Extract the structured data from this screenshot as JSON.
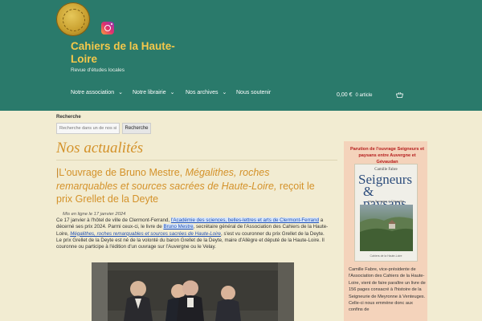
{
  "site": {
    "title": "Cahiers de la Haute-Loire",
    "tagline": "Revue d'études locales",
    "colors": {
      "header": "#2a7a6b",
      "title": "#f4c84a",
      "accent": "#d4922a",
      "background": "#f2ecd2"
    },
    "logo_icon": "gold-coin-logo",
    "social_icon": "instagram-icon"
  },
  "nav": {
    "items": [
      {
        "label": "Notre association",
        "has_dropdown": true
      },
      {
        "label": "Notre librairie",
        "has_dropdown": true
      },
      {
        "label": "Nos archives",
        "has_dropdown": true
      },
      {
        "label": "Nous soutenir",
        "has_dropdown": false
      }
    ],
    "cart": {
      "amount": "0,00 €",
      "count": "0 article",
      "icon": "basket-icon"
    }
  },
  "search": {
    "label": "Recherche",
    "placeholder": "Recherche dans un de nos si",
    "button": "Recherche"
  },
  "page": {
    "title": "Nos actualités"
  },
  "post": {
    "title_plain_1": "L'ouvrage de Bruno Mestre, ",
    "title_italic": "Mégalithes, roches remarquables et sources sacrées de Haute-Loire,",
    "title_plain_2": " reçoit le prix Grellet de la Deyte",
    "meta": "Mis en ligne le 17 janvier 2024",
    "p1_a": "Ce 17 janvier à l'hôtel de ville de Clermont-Ferrand, ",
    "p1_link": "l'Académie des sciences, belles-lettres et arts de Clermont-Ferrand",
    "p1_b": " a décerné ses prix 2024. Parmi ceux-ci, le livre de ",
    "p1_author": "Bruno Mestre",
    "p1_c": ", secrétaire général de l'Association des Cahiers de la Haute-Loire, ",
    "p1_book": "Mégalithes, roches remarquables et sources sacrées de Haute-Loire",
    "p1_d": ", s'est vu couronner du prix Grellet de la Deyte.",
    "p2": "Le prix Grellet de la Deyte est né de la volonté du baron Grellet de la Deyte, maire d'Allègre et député de la Haute-Loire. Il couronne ou participe à l'édition d'un ouvrage sur l'Auvergne ou le Velay."
  },
  "sidebar": {
    "heading": "Parution de l'ouvrage Seigneurs et paysans entre Auvergne et Gévaudan",
    "book": {
      "author": "Camille Fabre",
      "title_line1": "Seigneurs",
      "title_line2": "& paysans",
      "subtitle": "entre Auvergne et Gévaudan",
      "publisher": "Cahiers de la Haute-Loire"
    },
    "text": "Camille Fabre, vice-présidente de l'Association des Cahiers de la Haute-Loire, vient de faire paraître un livre de 156 pages consacré à l'histoire de la Seigneurie de Meyronne à Venteuges. Celle-ci nous emmène donc aux confins de"
  }
}
